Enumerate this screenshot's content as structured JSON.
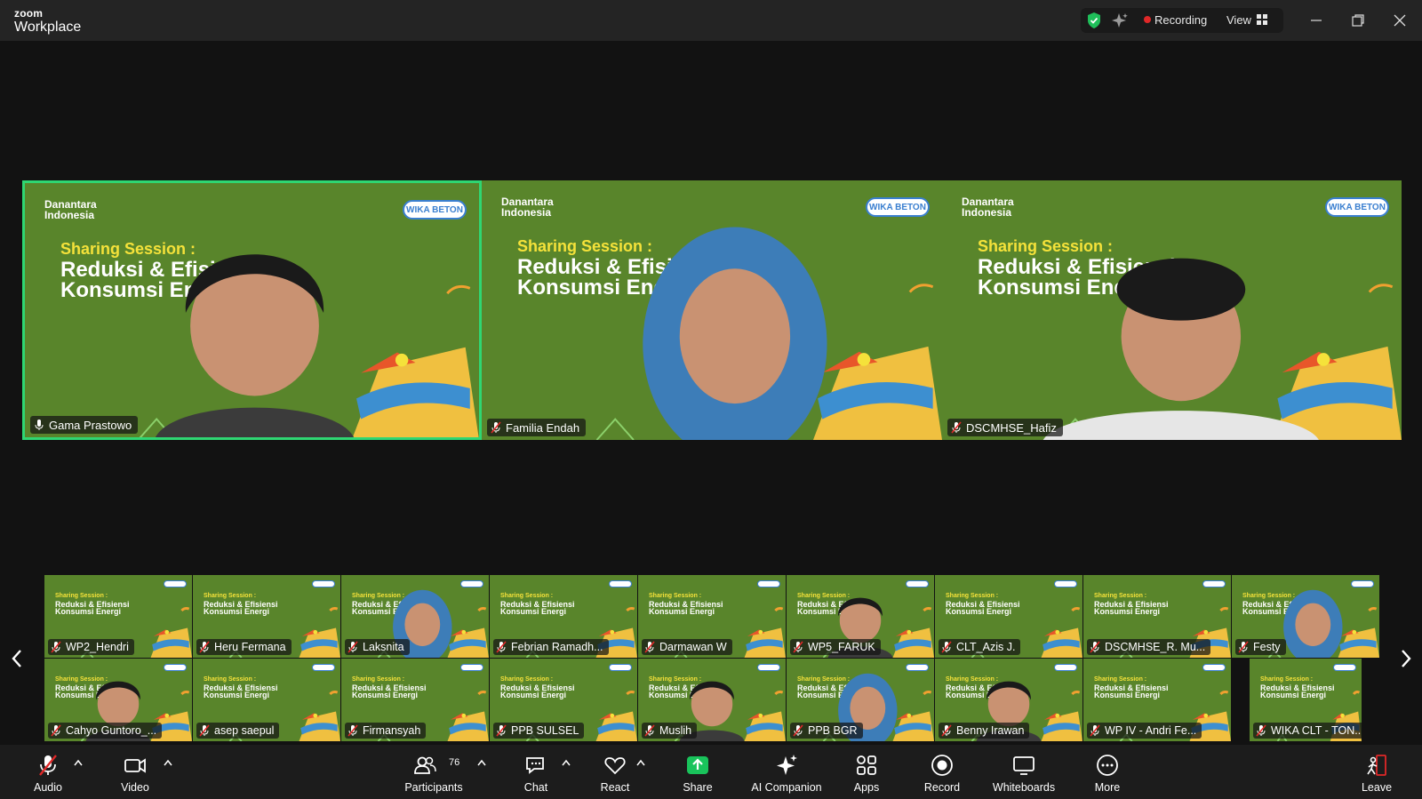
{
  "app": {
    "brand_small": "zoom",
    "brand_large": "Workplace"
  },
  "titlebar": {
    "recording_label": "Recording",
    "view_label": "View"
  },
  "slide": {
    "org_line1": "Danantara",
    "org_line2": "Indonesia",
    "logo_text": "WIKA BETON",
    "session_label": "Sharing Session :",
    "title_line1": "Reduksi & Efisiensi",
    "title_line2": "Konsumsi Energi"
  },
  "speakers": [
    {
      "name": "Gama Prastowo",
      "active": true,
      "muted": false
    },
    {
      "name": "Familia Endah",
      "active": false,
      "muted": true
    },
    {
      "name": "DSCMHSE_Hafiz",
      "active": false,
      "muted": true
    }
  ],
  "gallery_row1": [
    "WP2_Hendri",
    "Heru Fermana",
    "Laksnita",
    "Febrian Ramadh...",
    "Darmawan W",
    "WP5_FARUK",
    "CLT_Azis J.",
    "DSCMHSE_R. Mu...",
    "Festy"
  ],
  "gallery_row2": [
    "Cahyo Guntoro_...",
    "asep saepul",
    "Firmansyah",
    "PPB SULSEL",
    "Muslih",
    "PPB BGR",
    "Benny Irawan",
    "WP IV - Andri Fe...",
    "WIKA CLT - TON..."
  ],
  "toolbar": {
    "audio": "Audio",
    "video": "Video",
    "participants": "Participants",
    "participants_count": "76",
    "chat": "Chat",
    "react": "React",
    "share": "Share",
    "ai_companion": "AI Companion",
    "apps": "Apps",
    "record": "Record",
    "whiteboards": "Whiteboards",
    "more": "More",
    "leave": "Leave"
  },
  "colors": {
    "active_speaker_border": "#2fd672",
    "slide_green": "#5e8a2e",
    "recording_dot": "#e02828",
    "share_green": "#19c35b"
  }
}
